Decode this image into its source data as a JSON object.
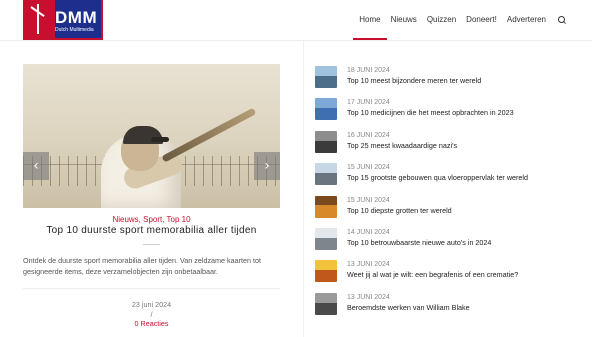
{
  "header": {
    "logo_text": "DMM",
    "logo_sub": "Dutch Multimedia",
    "nav": [
      "Home",
      "Nieuws",
      "Quizzen",
      "Doneert!",
      "Adverteren"
    ]
  },
  "featured": {
    "categories": "Nieuws, Sport, Top 10",
    "title": "Top 10 duurste sport memorabilia aller tijden",
    "excerpt": "Ontdek de duurste sport memorabilia aller tijden. Van zeldzame kaarten tot gesigneerde items, deze verzamelobjecten zijn onbetaalbaar.",
    "date": "23 juni 2024",
    "slash": "/",
    "comments": "0 Reacties",
    "prev_arrow": "‹",
    "next_arrow": "›"
  },
  "list": [
    {
      "date": "18 JUNI 2024",
      "title": "Top 10 meest bijzondere meren ter wereld",
      "sky": "#9fc3de",
      "ground": "#4d6e8a"
    },
    {
      "date": "17 JUNI 2024",
      "title": "Top 10 medicijnen die het meest opbrachten in 2023",
      "sky": "#7ea9d6",
      "ground": "#3f6fb0"
    },
    {
      "date": "16 JUNI 2024",
      "title": "Top 25 meest kwaadaardige nazi's",
      "sky": "#8d8d8d",
      "ground": "#3b3b3b"
    },
    {
      "date": "15 JUNI 2024",
      "title": "Top 15 grootste gebouwen qua vloeroppervlak ter wereld",
      "sky": "#c7d7e6",
      "ground": "#6b7580"
    },
    {
      "date": "15 JUNI 2024",
      "title": "Top 10 diepste grotten ter wereld",
      "sky": "#7a4a1e",
      "ground": "#d88a2a"
    },
    {
      "date": "14 JUNI 2024",
      "title": "Top 10 betrouwbaarste nieuwe auto's in 2024",
      "sky": "#e3e6ea",
      "ground": "#7f858c"
    },
    {
      "date": "13 JUNI 2024",
      "title": "Weet jij al wat je wilt: een begrafenis of een crematie?",
      "sky": "#f3c23a",
      "ground": "#c0581c"
    },
    {
      "date": "13 JUNI 2024",
      "title": "Beroemdste werken van William Blake",
      "sky": "#9a9a9a",
      "ground": "#4a4a4a"
    }
  ]
}
